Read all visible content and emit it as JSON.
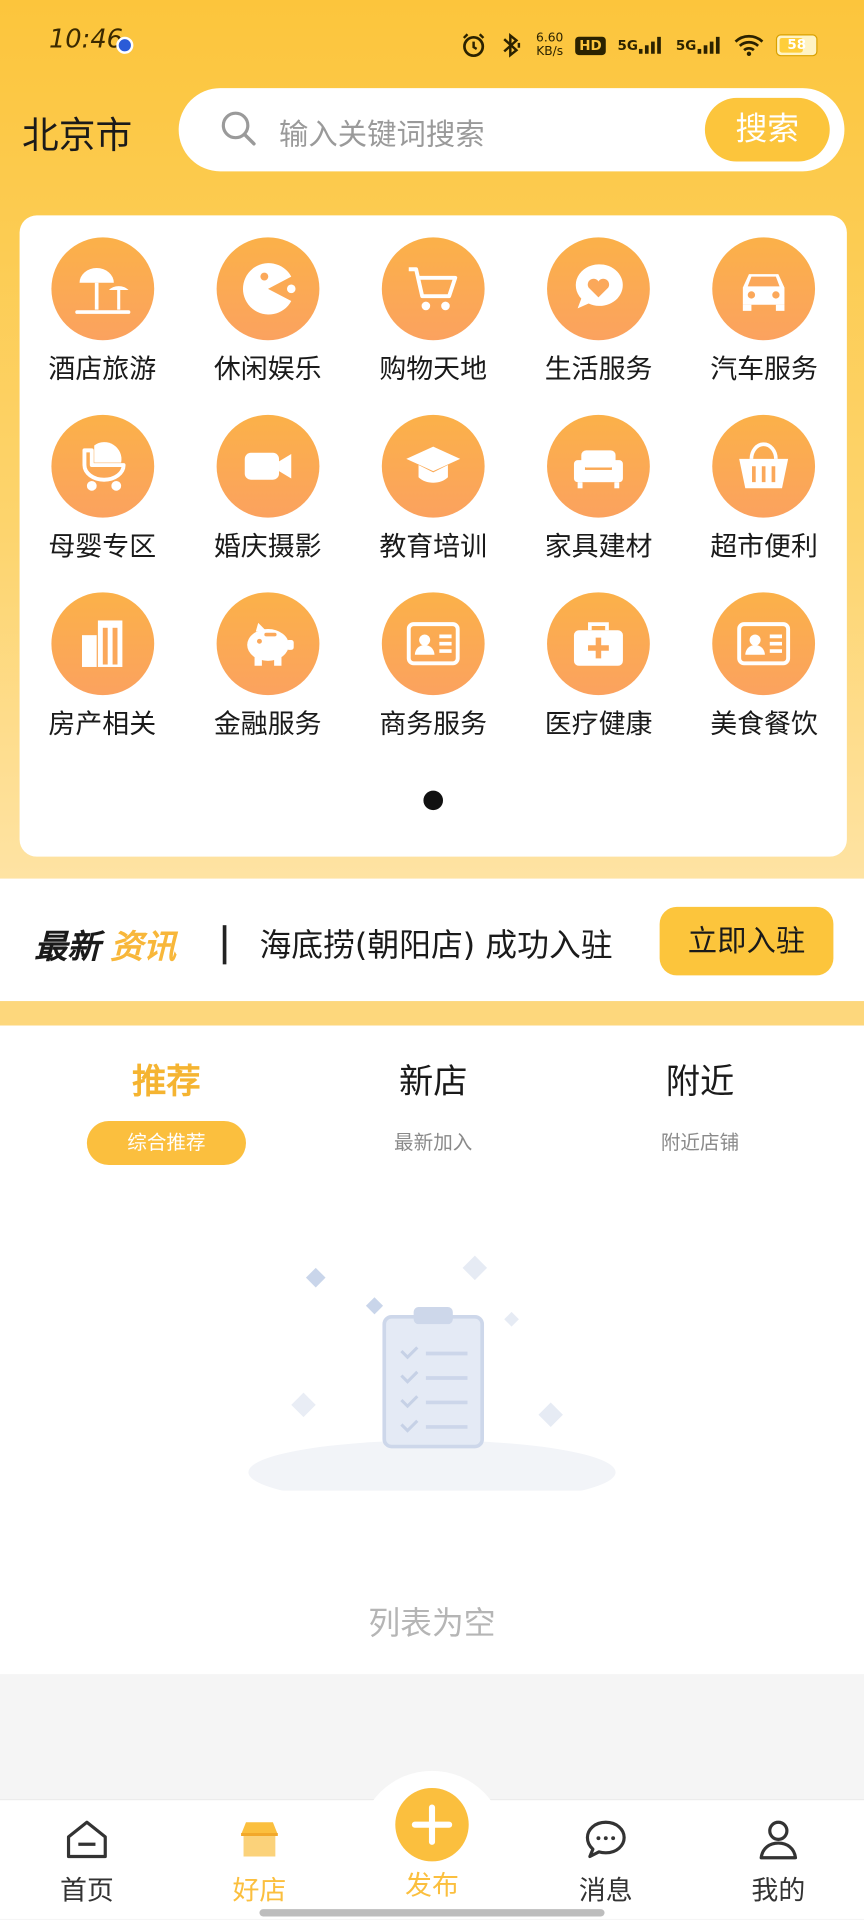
{
  "status_bar": {
    "time": "10:46",
    "net_speed": "6.60",
    "net_unit": "KB/s",
    "hd": "HD",
    "sim1": "5G",
    "sim2": "5G",
    "battery": "58"
  },
  "header": {
    "city": "北京市",
    "search_placeholder": "输入关键词搜索",
    "search_button": "搜索"
  },
  "categories": [
    {
      "label": "酒店旅游",
      "icon": "beach-umbrella-icon"
    },
    {
      "label": "休闲娱乐",
      "icon": "pacman-icon"
    },
    {
      "label": "购物天地",
      "icon": "shopping-cart-icon"
    },
    {
      "label": "生活服务",
      "icon": "heart-chat-icon"
    },
    {
      "label": "汽车服务",
      "icon": "car-icon"
    },
    {
      "label": "母婴专区",
      "icon": "stroller-icon"
    },
    {
      "label": "婚庆摄影",
      "icon": "video-camera-icon"
    },
    {
      "label": "教育培训",
      "icon": "graduation-cap-icon"
    },
    {
      "label": "家具建材",
      "icon": "sofa-icon"
    },
    {
      "label": "超市便利",
      "icon": "basket-icon"
    },
    {
      "label": "房产相关",
      "icon": "building-icon"
    },
    {
      "label": "金融服务",
      "icon": "piggy-bank-icon"
    },
    {
      "label": "商务服务",
      "icon": "id-card-icon"
    },
    {
      "label": "医疗健康",
      "icon": "medical-kit-icon"
    },
    {
      "label": "美食餐饮",
      "icon": "id-card-icon"
    }
  ],
  "news": {
    "title_dark": "最新",
    "title_accent": "资讯",
    "message": "海底捞(朝阳店) 成功入驻",
    "join_button": "立即入驻"
  },
  "tabs": [
    {
      "name": "推荐",
      "sub": "综合推荐",
      "active": true
    },
    {
      "name": "新店",
      "sub": "最新加入",
      "active": false
    },
    {
      "name": "附近",
      "sub": "附近店铺",
      "active": false
    }
  ],
  "empty_text": "列表为空",
  "bottom_nav": [
    {
      "label": "首页",
      "icon": "home-icon"
    },
    {
      "label": "好店",
      "icon": "shop-icon",
      "active": true
    },
    {
      "label": "发布",
      "icon": "plus-icon"
    },
    {
      "label": "消息",
      "icon": "message-icon"
    },
    {
      "label": "我的",
      "icon": "user-icon"
    }
  ],
  "colors": {
    "accent": "#fcc53c",
    "icon_circle": "#fba85a",
    "active_text": "#f5b431"
  }
}
